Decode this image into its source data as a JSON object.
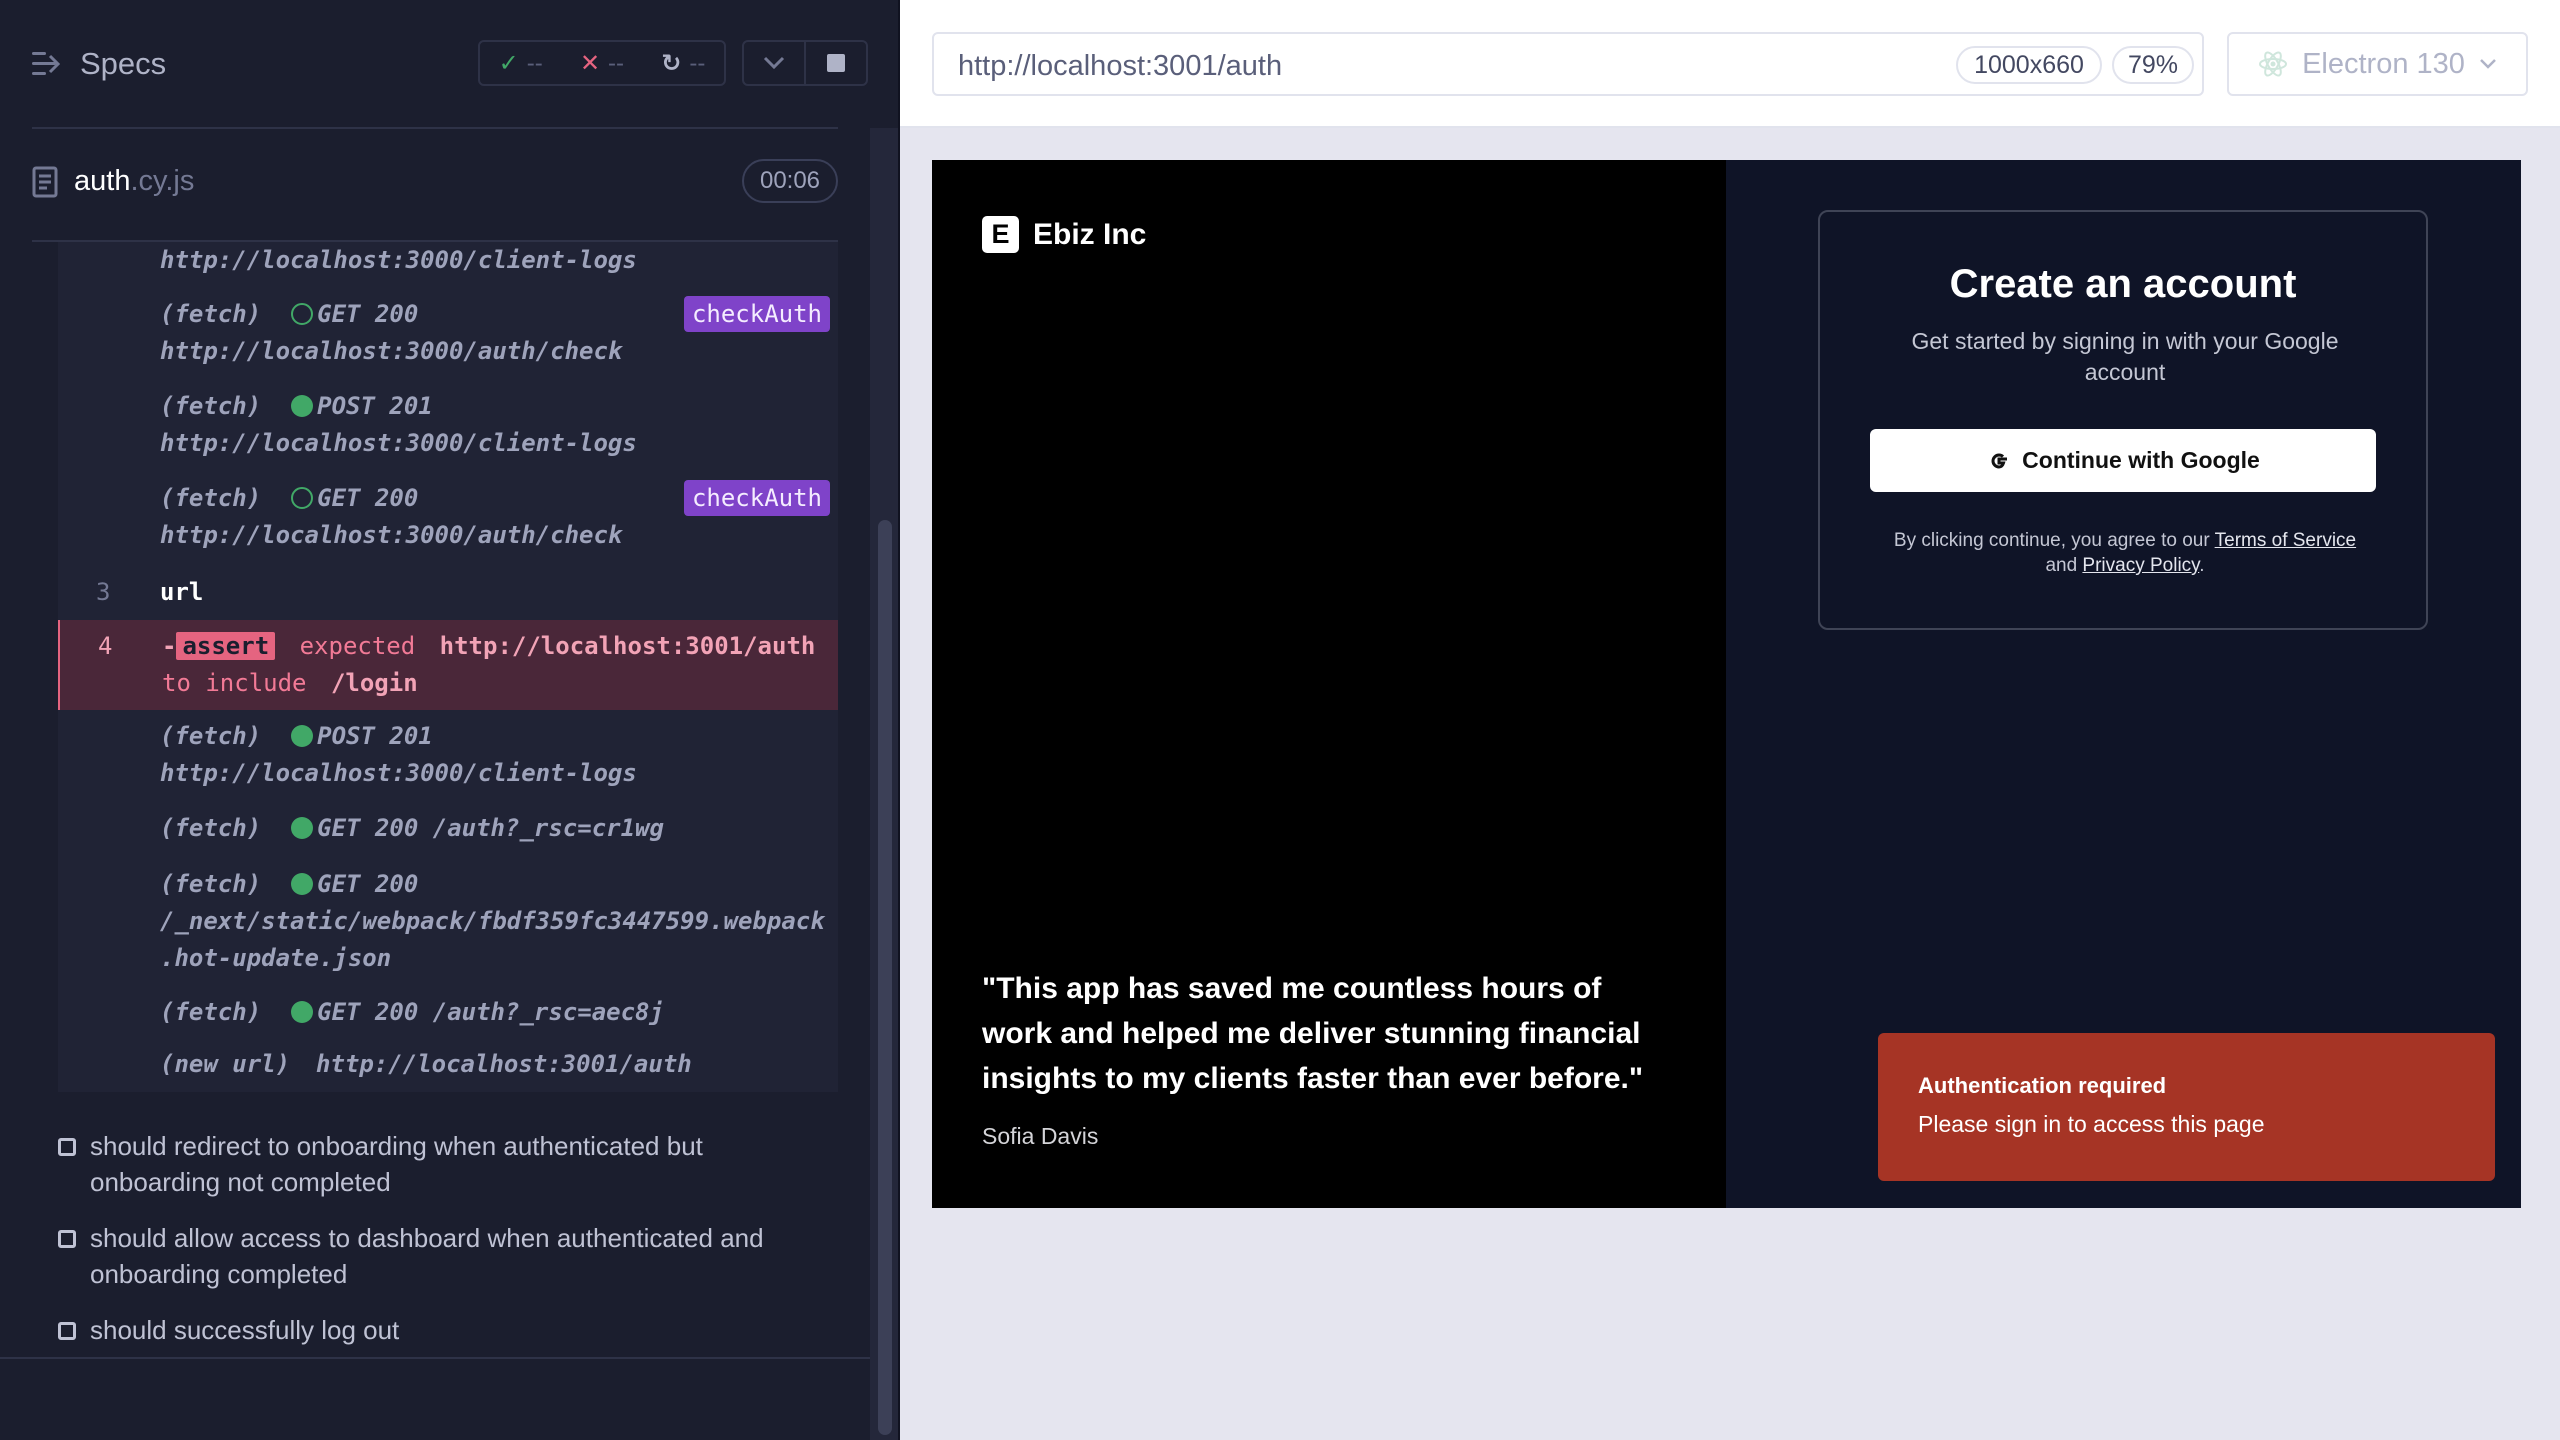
{
  "reporter": {
    "title": "Specs",
    "stats": {
      "passed": "--",
      "failed": "--",
      "pending": "--"
    },
    "spec_file": {
      "name": "auth",
      "ext": ".cy.js"
    },
    "timer": "00:06",
    "log": {
      "top_url": "http://localhost:3000/client-logs",
      "entry1": {
        "type": "(fetch)",
        "status": "GET 200",
        "url": "http://localhost:3000/auth/check",
        "alias": "checkAuth"
      },
      "entry2": {
        "type": "(fetch)",
        "status": "POST 201",
        "url": "http://localhost:3000/client-logs"
      },
      "entry3": {
        "type": "(fetch)",
        "status": "GET 200",
        "url": "http://localhost:3000/auth/check",
        "alias": "checkAuth"
      },
      "cmd3": {
        "num": "3",
        "name": "url"
      },
      "cmd4": {
        "num": "4",
        "prefix": "-",
        "badge": "assert",
        "expected": "expected",
        "actual": "http://localhost:3001/auth",
        "to_include": "to include",
        "value": "/login"
      },
      "entry4": {
        "type": "(fetch)",
        "status": "POST 201",
        "url": "http://localhost:3000/client-logs"
      },
      "entry5": {
        "type": "(fetch)",
        "status": "GET 200 /auth?_rsc=cr1wg"
      },
      "entry6": {
        "type": "(fetch)",
        "status": "GET 200",
        "url1": "/_next/static/webpack/fbdf359fc3447599.webpack",
        "url2": ".hot-update.json"
      },
      "entry7": {
        "type": "(fetch)",
        "status": "GET 200 /auth?_rsc=aec8j"
      },
      "entry8": {
        "type": "(new url)",
        "url": "http://localhost:3001/auth"
      }
    },
    "tests": [
      "should redirect to onboarding when authenticated but onboarding not completed",
      "should allow access to dashboard when authenticated and onboarding completed",
      "should successfully log out"
    ]
  },
  "aut": {
    "url": "http://localhost:3001/auth",
    "viewport_size": "1000x660",
    "zoom": "79%",
    "browser": "Electron 130"
  },
  "app": {
    "brand_initial": "E",
    "brand": "Ebiz Inc",
    "quote": "\"This app has saved me countless hours of work and helped me deliver stunning financial insights to my clients faster than ever before.\"",
    "author": "Sofia Davis",
    "card_title": "Create an account",
    "card_subtitle": "Get started by signing in with your Google account",
    "google_button": "Continue with Google",
    "terms_prefix": "By clicking continue, you agree to our",
    "terms_link": "Terms of Service",
    "terms_and": "and",
    "privacy_link": "Privacy Policy",
    "terms_suffix": ".",
    "toast_title": "Authentication required",
    "toast_message": "Please sign in to access this page"
  },
  "colors": {
    "reporter_bg": "#1b1e2e",
    "pass_green": "#41a867",
    "fail_red": "#e56480",
    "alias_purple": "#7f43c9",
    "toast_red": "#a63425"
  }
}
